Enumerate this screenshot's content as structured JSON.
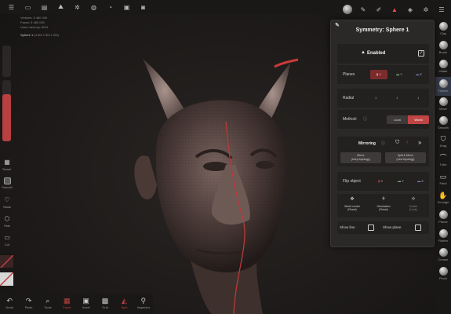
{
  "topbar": {
    "left_icons": [
      "menu-icon",
      "folder-icon",
      "save-icon",
      "mountain-icon",
      "gear-icon",
      "globe-icon",
      "clock-icon",
      "image-icon",
      "camera-icon"
    ],
    "right_icons": [
      "material-ball-icon",
      "brush-settings-icon",
      "pen-icon",
      "symmetry-icon",
      "layers-icon",
      "settings-icon",
      "list-icon"
    ]
  },
  "info": {
    "line1": "Vertices: 5 480 000",
    "line2": "Faces: 5 480 000",
    "line3": "Used memory: 80%"
  },
  "scene": {
    "name": "Sphere 1",
    "detail": "(4.5M  1.5M  1.0M)"
  },
  "leftbar": {
    "items": [
      {
        "label": "Tessel.",
        "icon": "grid-icon"
      },
      {
        "label": "Smooth",
        "icon": "cube-icon"
      },
      {
        "label": "Mask",
        "icon": "mask-icon"
      },
      {
        "label": "Hide",
        "icon": "hide-icon"
      },
      {
        "label": "Cut",
        "icon": "cut-icon"
      }
    ]
  },
  "bottombar": {
    "items": [
      {
        "label": "Undo",
        "icon": "↶"
      },
      {
        "label": "Redo",
        "icon": "↷"
      },
      {
        "label": "Tools",
        "icon": "⌕"
      },
      {
        "label": "Facet",
        "icon": "▦"
      },
      {
        "label": "Voxel",
        "icon": "▣"
      },
      {
        "label": "Grid",
        "icon": "▩"
      },
      {
        "label": "Sym",
        "icon": "◭"
      },
      {
        "label": "Inspector",
        "icon": "⚲"
      }
    ]
  },
  "rightstrip": {
    "items": [
      "Clay",
      "Brush",
      "Inflate",
      "Flatten",
      "Move",
      "Smooth",
      "Drag",
      "Tube",
      "Paint",
      "Smudge",
      "Planar",
      "Flatten",
      "Crease",
      "Pinch"
    ]
  },
  "panel": {
    "title_prefix": "Symmetry:",
    "title_object": "Sphere 1",
    "enabled_label": "Enabled",
    "enabled_checked": true,
    "planes_label": "Planes",
    "planes": [
      "X",
      "Y",
      "Z"
    ],
    "radial_label": "Radial",
    "radial_values": [
      "1",
      "1",
      "1"
    ],
    "method_label": "Method:",
    "method_options": [
      "Local",
      "World"
    ],
    "method_selected": "World",
    "mirroring_label": "Mirroring",
    "mirror_btn1_line1": "Mirror",
    "mirror_btn1_line2": "(keep topology)",
    "mirror_btn2_line1": "Split & Mirror",
    "mirror_btn2_line2": "(new topology)",
    "flip_label": "Flip object",
    "flip_axes": [
      "X",
      "Y",
      "Z"
    ],
    "pivot1_line1": "World center",
    "pivot1_line2": "(Reset)",
    "pivot2_line1": "Orientation",
    "pivot2_line2": "(Reset)",
    "pivot3_line1": "Center",
    "pivot3_line2": "(Lock)",
    "show_line_label": "Show line",
    "show_plane_label": "Show plane"
  },
  "colors": {
    "accent": "#c04444",
    "panel_bg": "#2b2928",
    "row_bg": "#232120"
  }
}
